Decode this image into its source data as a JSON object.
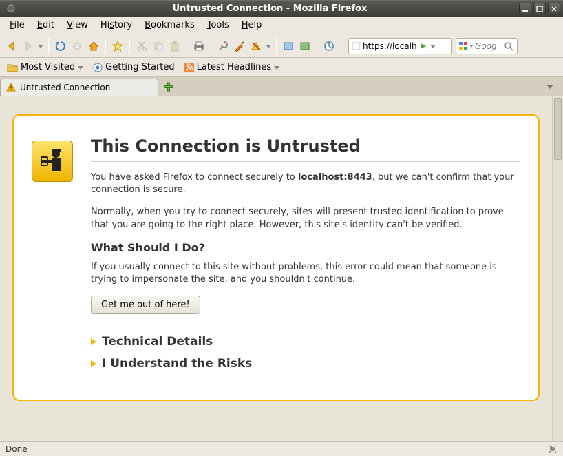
{
  "window": {
    "title": "Untrusted Connection - Mozilla Firefox"
  },
  "menubar": {
    "file": "File",
    "edit": "Edit",
    "view": "View",
    "history": "History",
    "bookmarks": "Bookmarks",
    "tools": "Tools",
    "help": "Help"
  },
  "url": {
    "value": "https://localho"
  },
  "search": {
    "placeholder": "Goog"
  },
  "bookmarks_bar": {
    "most_visited": "Most Visited",
    "getting_started": "Getting Started",
    "latest_headlines": "Latest Headlines"
  },
  "tab": {
    "title": "Untrusted Connection"
  },
  "error": {
    "heading": "This Connection is Untrusted",
    "p1a": "You have asked Firefox to connect securely to ",
    "p1b": "localhost:8443",
    "p1c": ", but we can't confirm that your connection is secure.",
    "p2": "Normally, when you try to connect securely, sites will present trusted identification to prove that you are going to the right place. However, this site's identity can't be verified.",
    "h3": "What Should I Do?",
    "p3": "If you usually connect to this site without problems, this error could mean that someone is trying to impersonate the site, and you shouldn't continue.",
    "getout": "Get me out of here!",
    "tech_details": "Technical Details",
    "risks": "I Understand the Risks"
  },
  "status": {
    "text": "Done"
  }
}
